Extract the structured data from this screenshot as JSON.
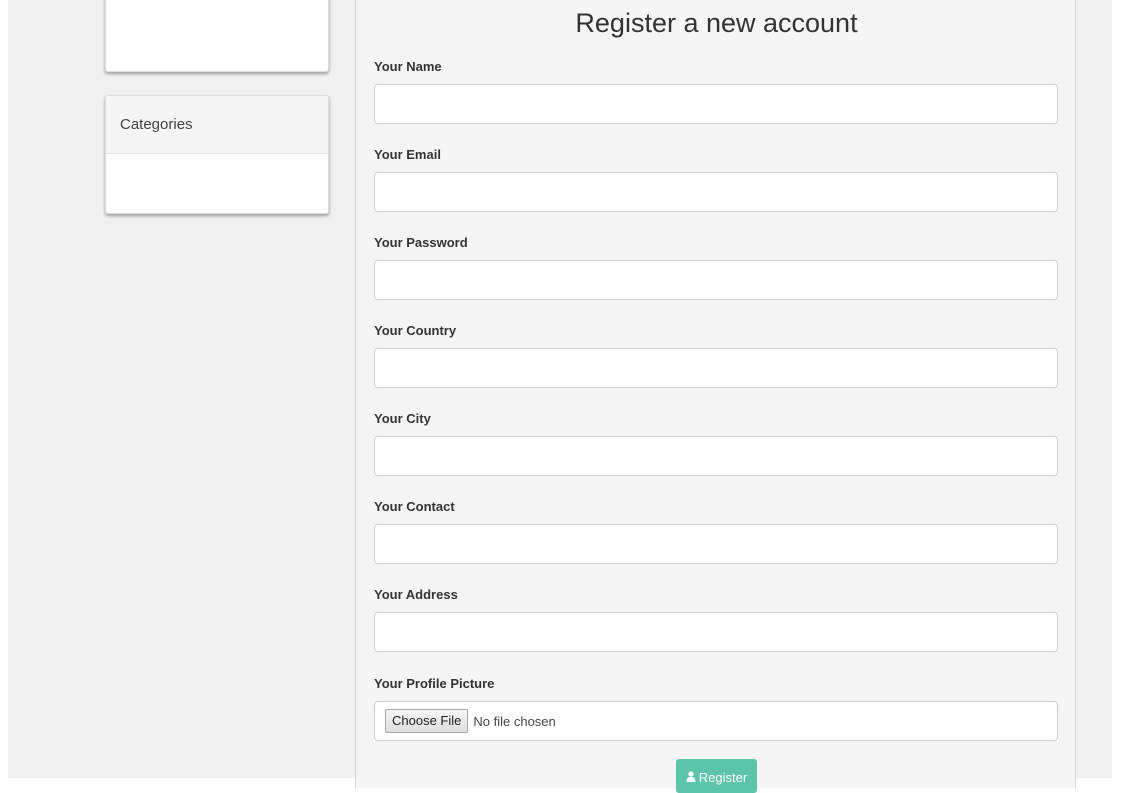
{
  "sidebar": {
    "categories_heading": "Categories"
  },
  "form": {
    "title": "Register a new account",
    "fields": [
      {
        "label": "Your Name",
        "value": ""
      },
      {
        "label": "Your Email",
        "value": ""
      },
      {
        "label": "Your Password",
        "value": ""
      },
      {
        "label": "Your Country",
        "value": ""
      },
      {
        "label": "Your City",
        "value": ""
      },
      {
        "label": "Your Contact",
        "value": ""
      },
      {
        "label": "Your Address",
        "value": ""
      }
    ],
    "picture_label": "Your Profile Picture",
    "choose_file_label": "Choose File",
    "file_status": "No file chosen",
    "submit_label": "Register",
    "submit_icon": "user-icon",
    "accent_color": "#5cc4a8"
  }
}
